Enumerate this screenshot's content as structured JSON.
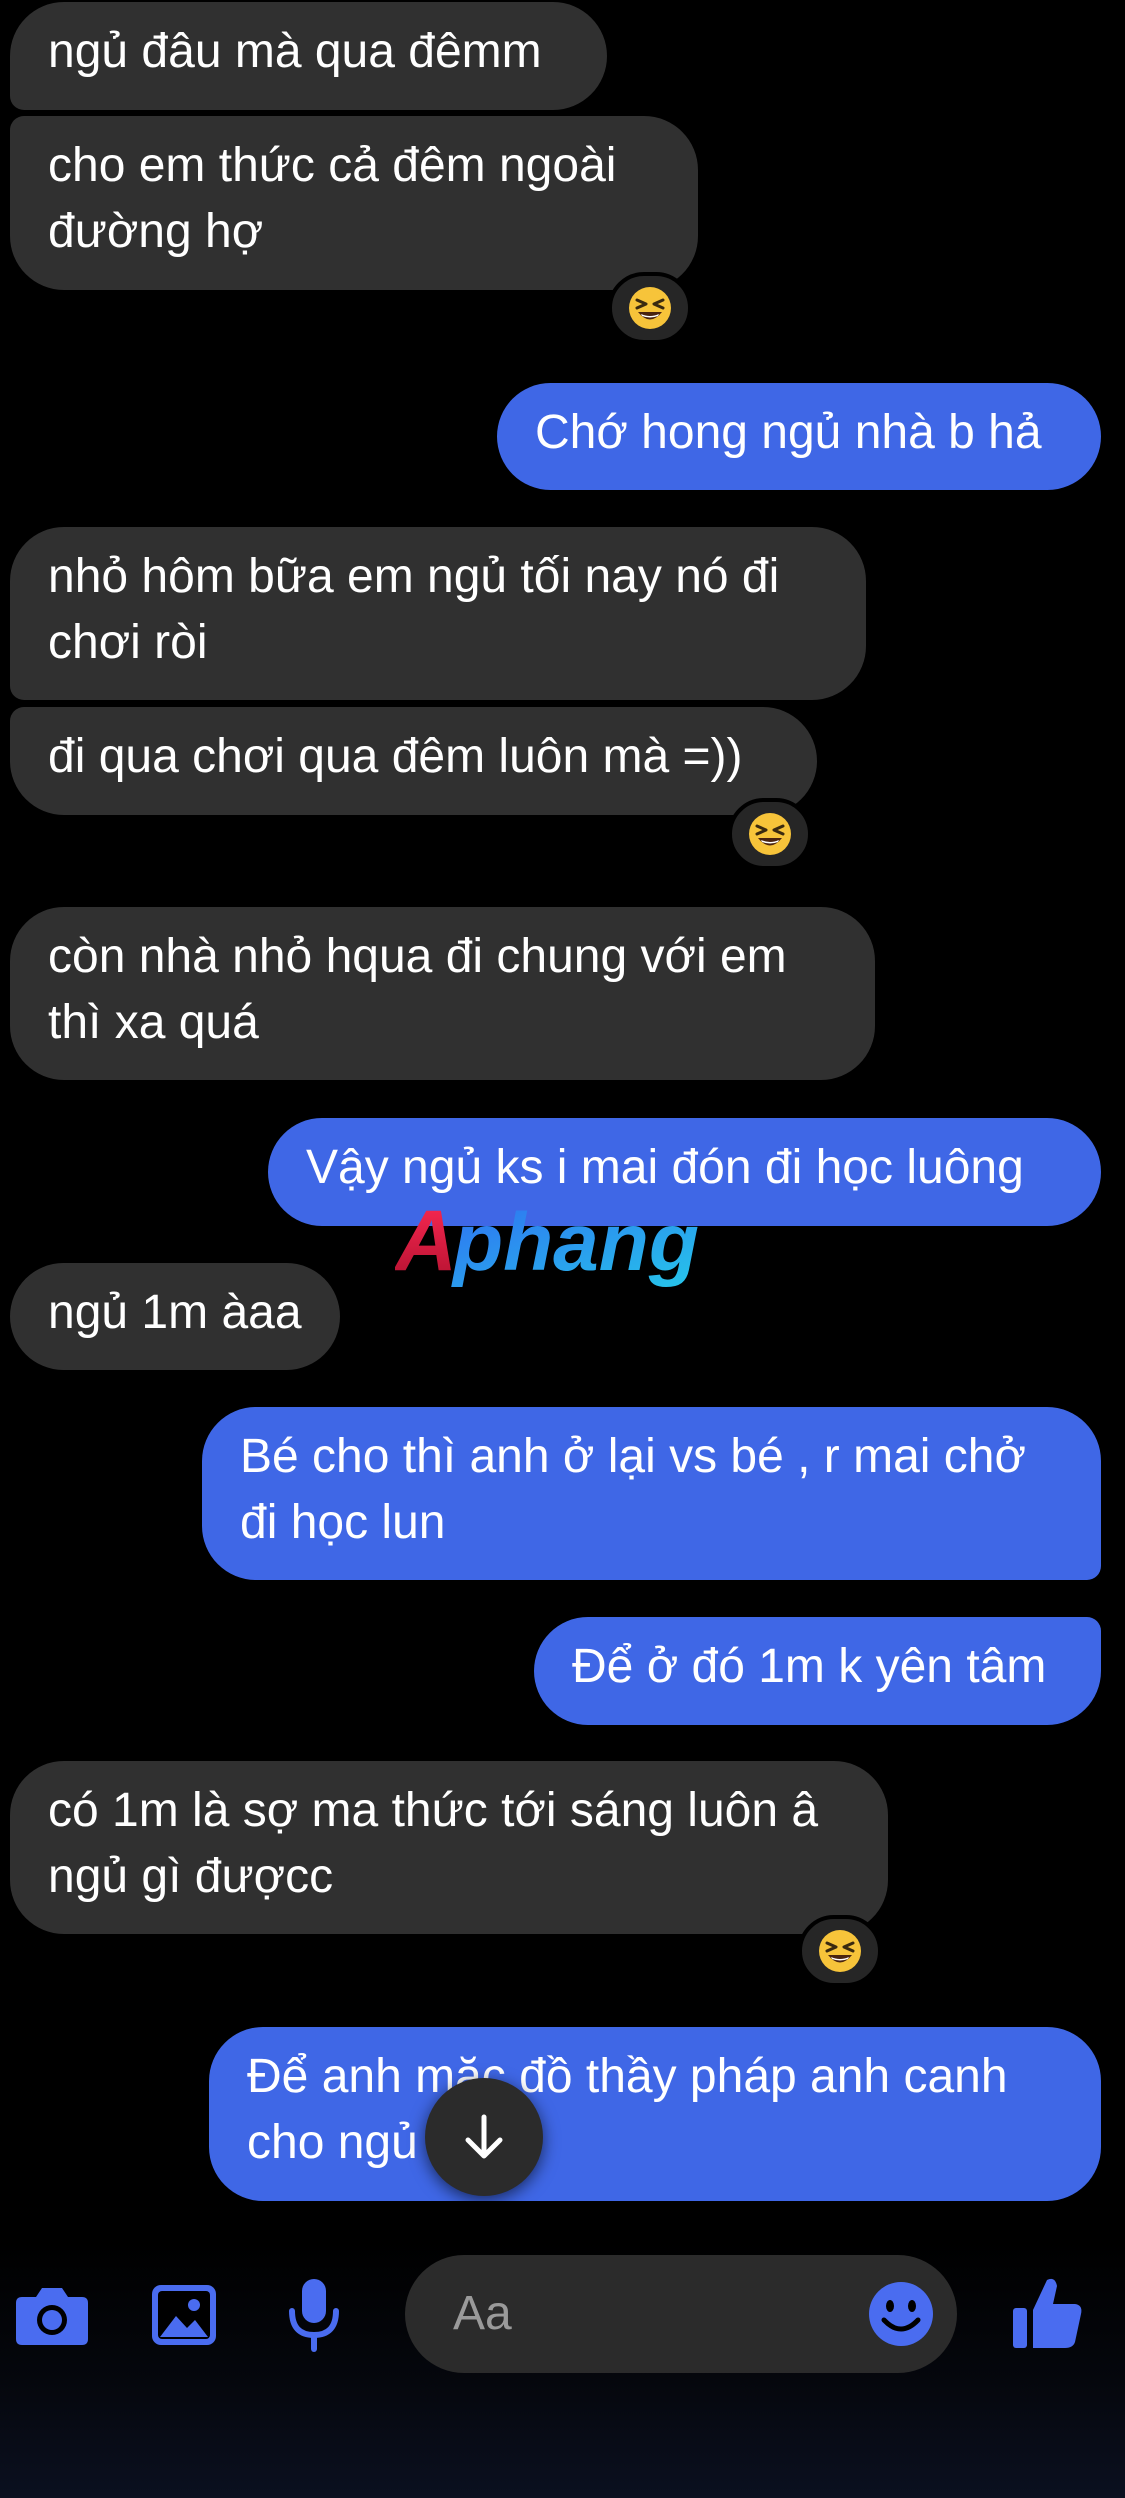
{
  "messages": [
    {
      "direction": "incoming",
      "text": "ngủ đâu mà qua đêmm"
    },
    {
      "direction": "incoming",
      "text": "cho em thức cả đêm ngoài đường hợ",
      "reaction": "😆"
    },
    {
      "direction": "outgoing",
      "text": "Chớ hong ngủ nhà b hả"
    },
    {
      "direction": "incoming",
      "text": "nhỏ hôm bữa em ngủ tối nay nó đi chơi ròi"
    },
    {
      "direction": "incoming",
      "text": "đi qua chơi qua đêm luôn mà =))",
      "reaction": "😆"
    },
    {
      "direction": "incoming",
      "text": "còn nhà nhỏ hqua đi chung với em thì xa quá"
    },
    {
      "direction": "outgoing",
      "text": "Vậy ngủ ks i mai đón đi học luông"
    },
    {
      "direction": "incoming",
      "text": "ngủ 1m àaa"
    },
    {
      "direction": "outgoing",
      "text": "Bé cho thì anh ở lại vs bé , r mai chở đi học lun"
    },
    {
      "direction": "outgoing",
      "text": "Để ở đó 1m k yên tâm"
    },
    {
      "direction": "incoming",
      "text": "có 1m là sợ ma thức tới sáng luôn â ngủ gì đượcc",
      "reaction": "😆"
    },
    {
      "direction": "outgoing",
      "text": "Để anh mặc đồ thầy pháp anh canh cho ngủ"
    }
  ],
  "watermark": {
    "text": "Aphang"
  },
  "composer": {
    "placeholder": "Aa",
    "icons": [
      "camera-icon",
      "image-icon",
      "microphone-icon",
      "emoji-icon",
      "thumbs-up-icon"
    ]
  },
  "scroll_button": {
    "icon": "arrow-down-icon"
  },
  "colors": {
    "background": "#000000",
    "incoming_bubble": "#303030",
    "outgoing_bubble": "#3f67e6",
    "accent": "#4a6cf0",
    "reaction_bg": "#262626"
  }
}
